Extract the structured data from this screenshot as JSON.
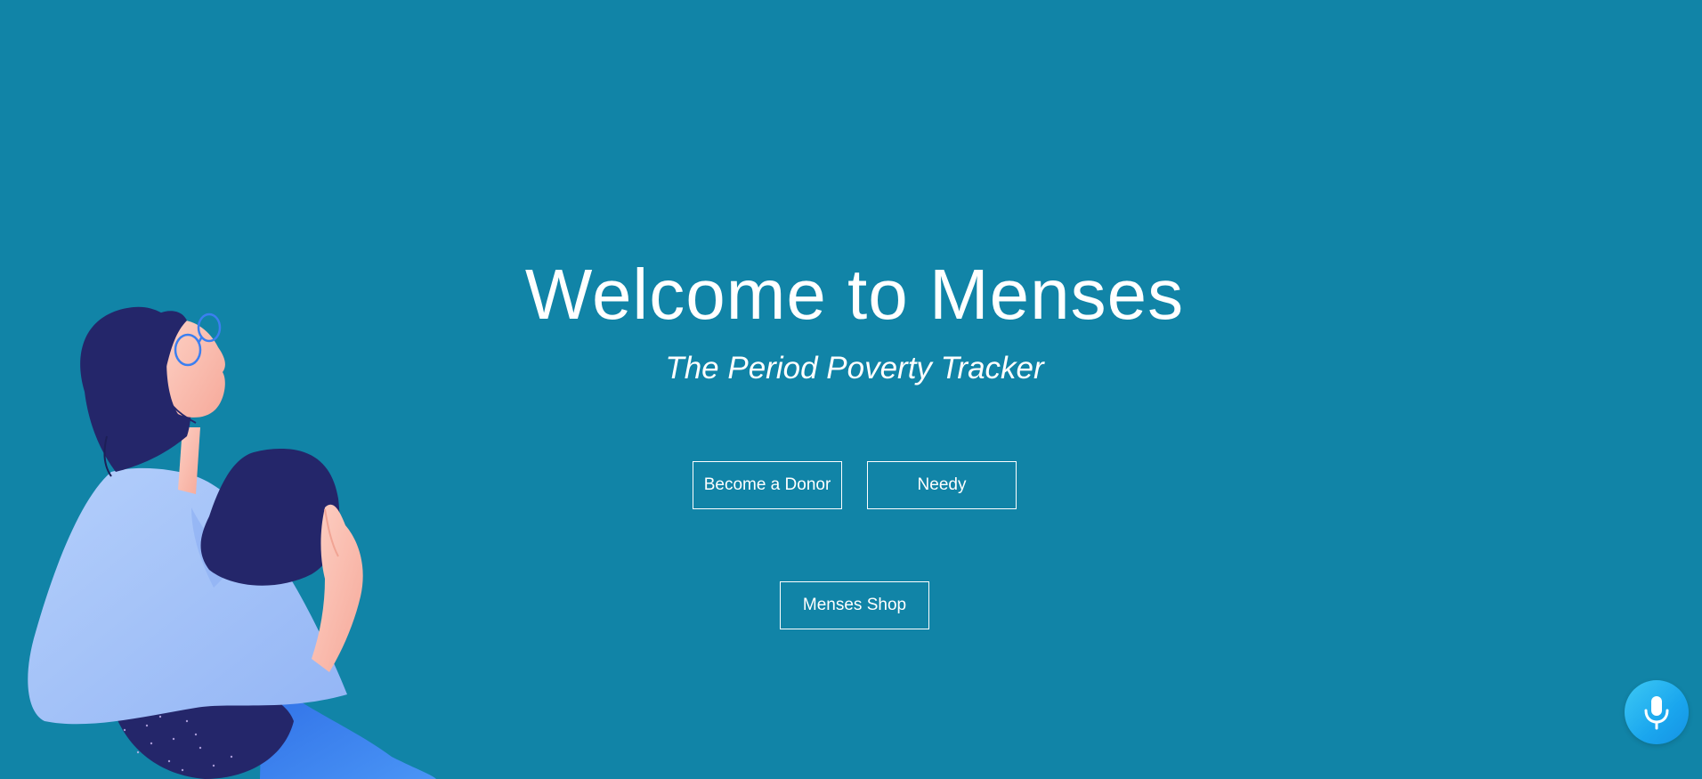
{
  "hero": {
    "title": "Welcome to Menses",
    "subtitle": "The Period Poverty Tracker"
  },
  "buttons": {
    "donor_label": "Become a Donor",
    "needy_label": "Needy",
    "shop_label": "Menses Shop"
  },
  "icons": {
    "voice": "microphone-icon",
    "illustration": "woman-sitting-illustration"
  },
  "colors": {
    "background": "#1184a7",
    "text": "#ffffff",
    "mic_button": "#1aa6ee",
    "hair": "#24266a",
    "shirt": "#a3c2f8",
    "skin": "#fbc2b3",
    "pants": "#3d8bf2"
  }
}
